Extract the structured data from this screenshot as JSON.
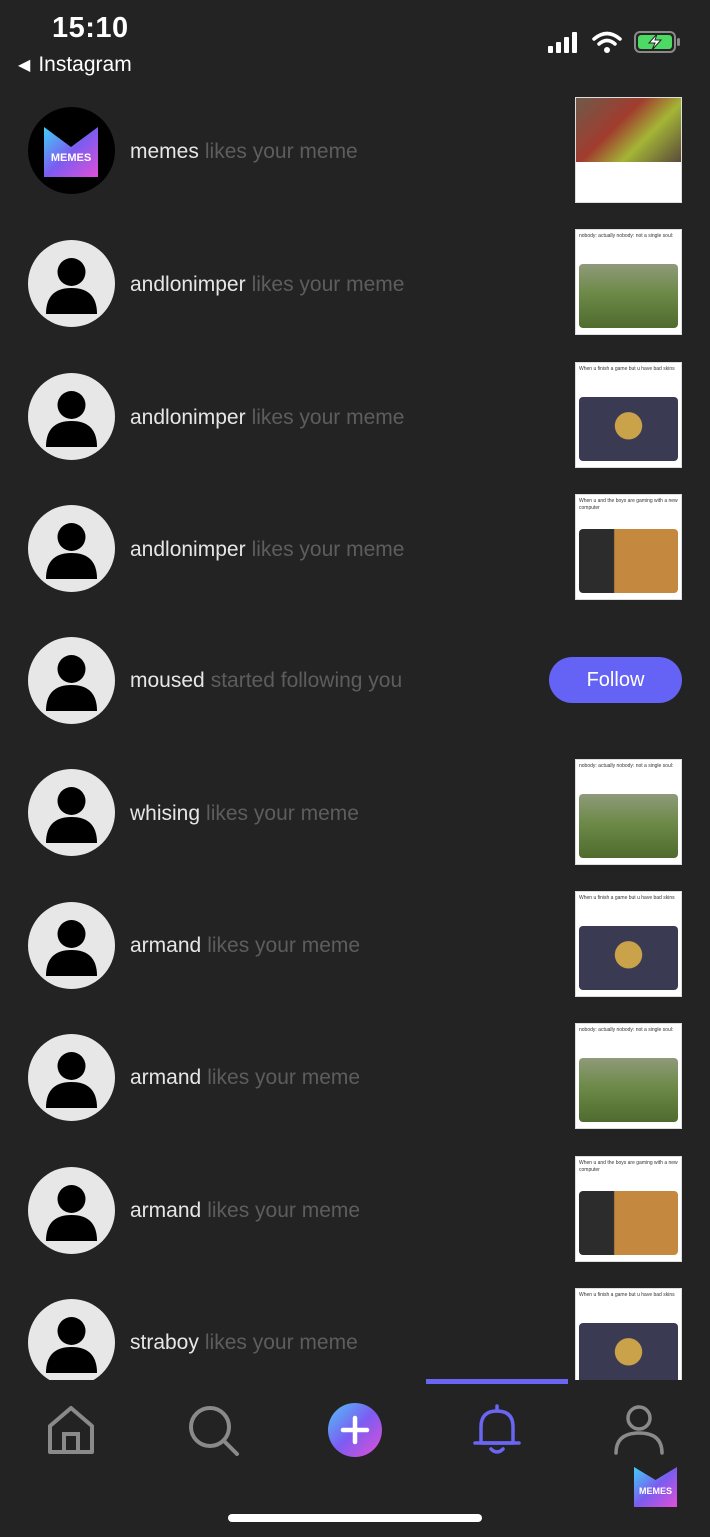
{
  "status_bar": {
    "time": "15:10",
    "back_label": "Instagram",
    "back_icon": "back-triangle-icon",
    "icons": [
      "cellular-signal-icon",
      "wifi-icon",
      "battery-charging-icon"
    ]
  },
  "notifications": [
    {
      "user": "memes",
      "action": "likes your meme",
      "avatar": "memes-logo",
      "thumb": "photo"
    },
    {
      "user": "andlonimper",
      "action": "likes your meme",
      "avatar": "default-user",
      "thumb": "grass",
      "caption": "nobody:\nactually nobody:\nnot a single soul:"
    },
    {
      "user": "andlonimper",
      "action": "likes your meme",
      "avatar": "default-user",
      "thumb": "trash",
      "caption": "When u finish a game but u have bad skins"
    },
    {
      "user": "andlonimper",
      "action": "likes your meme",
      "avatar": "default-user",
      "thumb": "dog",
      "caption": "When u and the boys are gaming with a new computer"
    },
    {
      "user": "moused",
      "action": "started following you",
      "avatar": "default-user",
      "follow_label": "Follow"
    },
    {
      "user": "whising",
      "action": "likes your meme",
      "avatar": "default-user",
      "thumb": "grass",
      "caption": "nobody:\nactually nobody:\nnot a single soul:"
    },
    {
      "user": "armand",
      "action": "likes your meme",
      "avatar": "default-user",
      "thumb": "trash",
      "caption": "When u finish a game but u have bad skins"
    },
    {
      "user": "armand",
      "action": "likes your meme",
      "avatar": "default-user",
      "thumb": "grass",
      "caption": "nobody:\nactually nobody:\nnot a single soul:"
    },
    {
      "user": "armand",
      "action": "likes your meme",
      "avatar": "default-user",
      "thumb": "dog",
      "caption": "When u and the boys are gaming with a new computer"
    },
    {
      "user": "straboy",
      "action": "likes your meme",
      "avatar": "default-user",
      "thumb": "trash",
      "caption": "When u finish a game but u have bad skins"
    }
  ],
  "brand": {
    "logo_text": "MEMES"
  },
  "tab_bar": {
    "tabs": [
      "home-icon",
      "search-icon",
      "create-post-icon",
      "notifications-bell-icon",
      "profile-icon"
    ],
    "active": "notifications-bell-icon"
  },
  "colors": {
    "background": "#232323",
    "accent": "#6463f5",
    "username": "#e6e6e6",
    "action_text": "#5d5d5d"
  }
}
